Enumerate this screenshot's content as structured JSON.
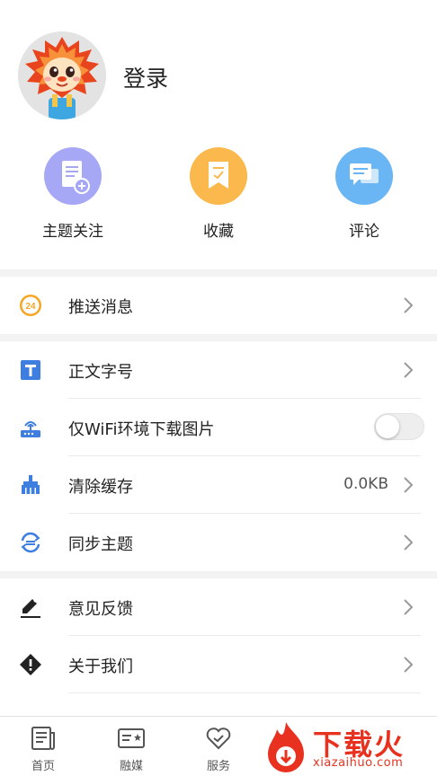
{
  "profile": {
    "login_label": "登录"
  },
  "quick_actions": [
    {
      "label": "主题关注",
      "icon": "document-add-icon",
      "color": "#a6a8f5"
    },
    {
      "label": "收藏",
      "icon": "bookmark-icon",
      "color": "#fbb84c"
    },
    {
      "label": "评论",
      "icon": "chat-bubble-icon",
      "color": "#6ab6f4"
    }
  ],
  "menu": {
    "push": {
      "label": "推送消息",
      "icon": "push-24-icon",
      "badge": "24"
    },
    "font_size": {
      "label": "正文字号",
      "icon": "text-size-icon"
    },
    "wifi_only": {
      "label": "仅WiFi环境下载图片",
      "icon": "router-icon",
      "enabled": false
    },
    "clear_cache": {
      "label": "清除缓存",
      "icon": "broom-icon",
      "value": "0.0KB"
    },
    "sync": {
      "label": "同步主题",
      "icon": "sync-icon"
    },
    "feedback": {
      "label": "意见反馈",
      "icon": "pencil-icon"
    },
    "about": {
      "label": "关于我们",
      "icon": "info-diamond-icon"
    }
  },
  "tabbar": [
    {
      "label": "首页",
      "icon": "newspaper-icon"
    },
    {
      "label": "融媒",
      "icon": "media-card-icon"
    },
    {
      "label": "服务",
      "icon": "heart-service-icon"
    }
  ],
  "watermark": {
    "text": "下载火",
    "subtext": "xiazaihuo.com"
  },
  "colors": {
    "accent_orange": "#f5a623",
    "accent_blue": "#3d7ee0",
    "watermark_red": "#e8321f"
  }
}
